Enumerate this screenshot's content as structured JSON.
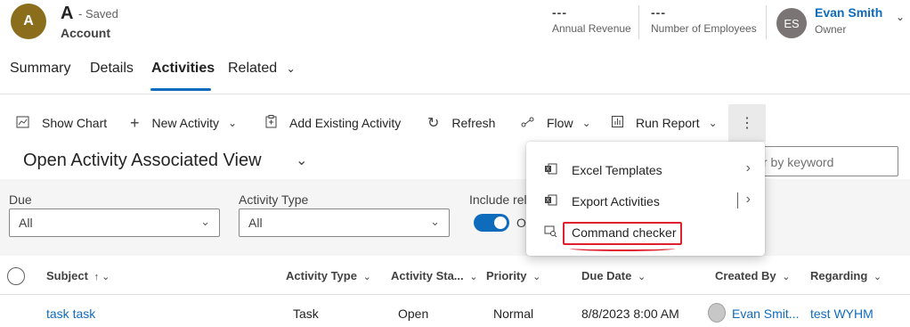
{
  "header": {
    "avatar_initial": "A",
    "record_title": "A",
    "saved_status": "- Saved",
    "entity_type": "Account",
    "fields": [
      {
        "value": "---",
        "label": "Annual Revenue"
      },
      {
        "value": "---",
        "label": "Number of Employees"
      }
    ],
    "owner": {
      "initials": "ES",
      "name": "Evan Smith",
      "label": "Owner"
    }
  },
  "tabs": [
    {
      "label": "Summary"
    },
    {
      "label": "Details"
    },
    {
      "label": "Activities",
      "active": true
    },
    {
      "label": "Related"
    }
  ],
  "commands": [
    {
      "label": "Show Chart",
      "icon": "chart-icon"
    },
    {
      "label": "New Activity",
      "icon": "plus-icon"
    },
    {
      "label": "Add Existing Activity",
      "icon": "clipboard-icon"
    },
    {
      "label": "Refresh",
      "icon": "refresh-icon"
    },
    {
      "label": "Flow",
      "icon": "flow-icon"
    },
    {
      "label": "Run Report",
      "icon": "report-icon"
    }
  ],
  "view": {
    "title": "Open Activity Associated View",
    "search_placeholder": "r by keyword"
  },
  "filters": {
    "due": {
      "label": "Due",
      "value": "All"
    },
    "activity_type": {
      "label": "Activity Type",
      "value": "All"
    },
    "include_related": {
      "label": "Include rel",
      "toggle_text": "O",
      "on": true
    }
  },
  "overflow_menu": {
    "items": [
      {
        "label": "Excel Templates",
        "icon": "excel-icon"
      },
      {
        "label": "Export Activities",
        "icon": "excel-export-icon"
      },
      {
        "label": "Command checker",
        "icon": "command-checker-icon"
      }
    ]
  },
  "grid": {
    "columns": [
      "Subject",
      "Activity Type",
      "Activity Sta...",
      "Priority",
      "Due Date",
      "Created By",
      "Regarding"
    ],
    "rows": [
      {
        "subject": "task task",
        "activity_type": "Task",
        "activity_status": "Open",
        "priority": "Normal",
        "due_date": "8/8/2023 8:00 AM",
        "created_by": "Evan Smit...",
        "regarding": "test WYHM"
      }
    ]
  },
  "colors": {
    "accent": "#0f6cbd",
    "avatar_account": "#8a6e1b",
    "avatar_owner": "#7a7574",
    "highlight": "#e0202f"
  }
}
